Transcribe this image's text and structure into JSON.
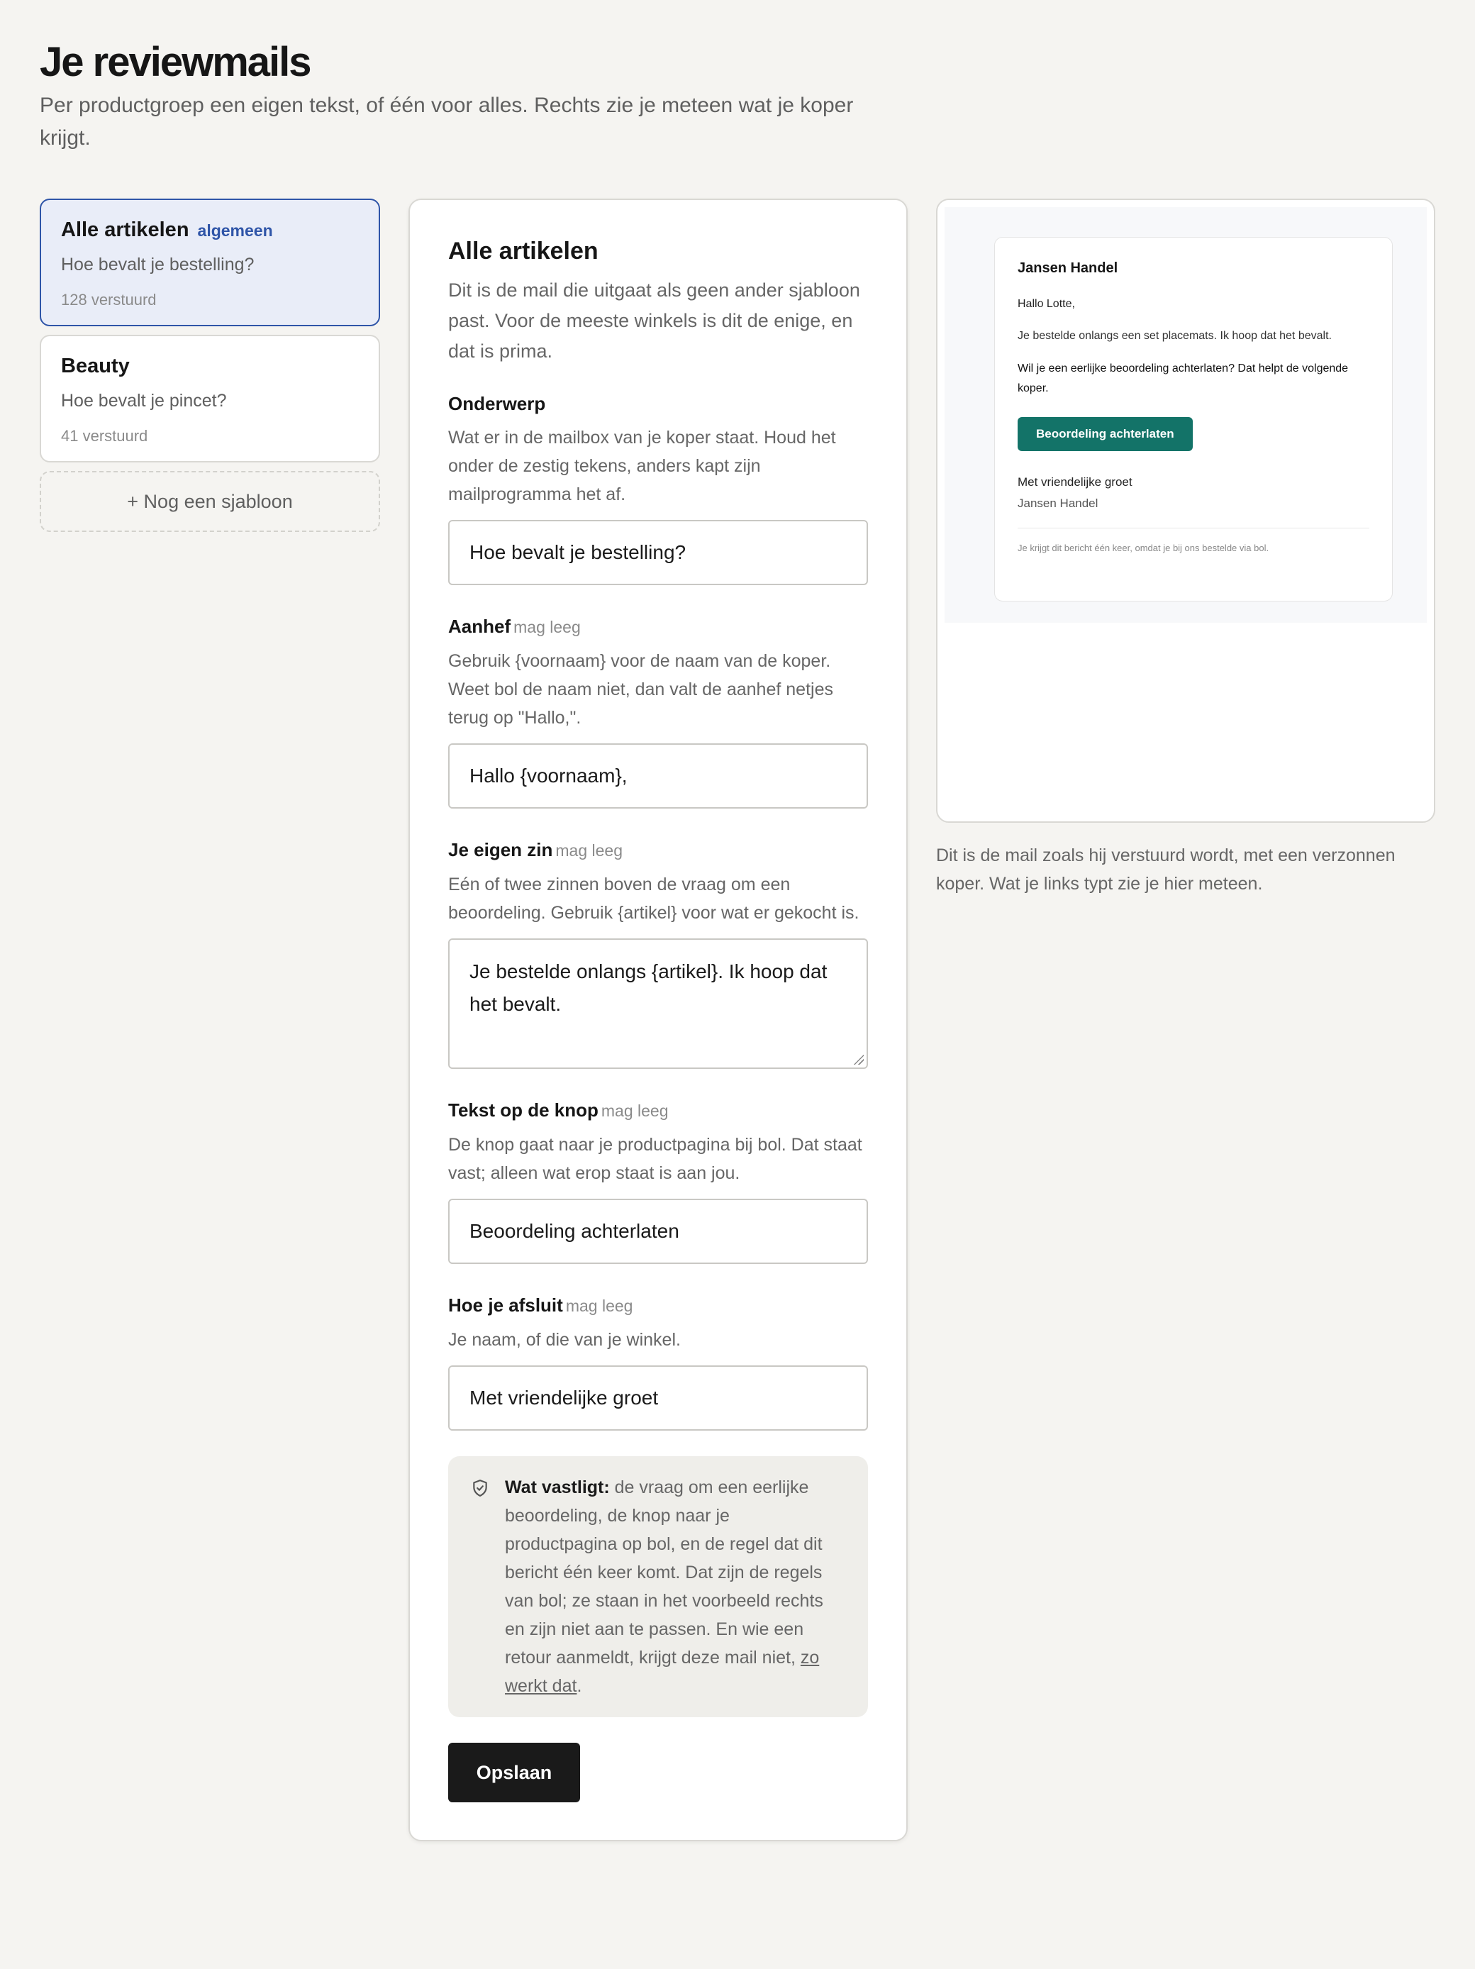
{
  "header": {
    "title": "Je reviewmails",
    "subtitle": "Per productgroep een eigen tekst, of één voor alles. Rechts zie je meteen wat je koper krijgt."
  },
  "templates": [
    {
      "name": "Alle artikelen",
      "tag": "algemeen",
      "subject": "Hoe bevalt je bestelling?",
      "count": "128 verstuurd"
    },
    {
      "name": "Beauty",
      "subject": "Hoe bevalt je pincet?",
      "count": "41 verstuurd"
    }
  ],
  "add_template_label": "+ Nog een sjabloon",
  "editor": {
    "title": "Alle artikelen",
    "description": "Dit is de mail die uitgaat als geen ander sjabloon past. Voor de meeste winkels is dit de enige, en dat is prima.",
    "optional_label": "mag leeg",
    "fields": {
      "subject": {
        "label": "Onderwerp",
        "help": "Wat er in de mailbox van je koper staat. Houd het onder de zestig tekens, anders kapt zijn mailprogramma het af.",
        "value": "Hoe bevalt je bestelling?"
      },
      "greeting": {
        "label": "Aanhef",
        "help": "Gebruik {voornaam} voor de naam van de koper. Weet bol de naam niet, dan valt de aanhef netjes terug op \"Hallo,\".",
        "value": "Hallo {voornaam},"
      },
      "own_sentence": {
        "label": "Je eigen zin",
        "help": "Eén of twee zinnen boven de vraag om een beoordeling. Gebruik {artikel} voor wat er gekocht is.",
        "value": "Je bestelde onlangs {artikel}. Ik hoop dat het bevalt."
      },
      "button_text": {
        "label": "Tekst op de knop",
        "help": "De knop gaat naar je productpagina bij bol. Dat staat vast; alleen wat erop staat is aan jou.",
        "value": "Beoordeling achterlaten"
      },
      "closing": {
        "label": "Hoe je afsluit",
        "help": "Je naam, of die van je winkel.",
        "value": "Met vriendelijke groet"
      }
    },
    "fixed_notice": {
      "strong": "Wat vastligt:",
      "text": " de vraag om een eerlijke beoordeling, de knop naar je productpagina op bol, en de regel dat dit bericht één keer komt. Dat zijn de regels van bol; ze staan in het voorbeeld rechts en zijn niet aan te passen. En wie een retour aanmeldt, krijgt deze mail niet, ",
      "link": "zo werkt dat",
      "end": "."
    },
    "save_label": "Opslaan"
  },
  "preview": {
    "shop_name": "Jansen Handel",
    "greeting": "Hallo Lotte,",
    "own_line": "Je bestelde onlangs een set placemats. Ik hoop dat het bevalt.",
    "question": "Wil je een eerlijke beoordeling achterlaten? Dat helpt de volgende koper.",
    "button": "Beoordeling achterlaten",
    "closing": "Met vriendelijke groet",
    "sender": "Jansen Handel",
    "footer": "Je krijgt dit bericht één keer, omdat je bij ons bestelde via bol.",
    "note": "Dit is de mail zoals hij verstuurd wordt, met een verzonnen koper. Wat je links typt zie je hier meteen."
  },
  "colors": {
    "active_border": "#2f55a8",
    "preview_button": "#137368",
    "save_button": "#1a1a1a"
  }
}
